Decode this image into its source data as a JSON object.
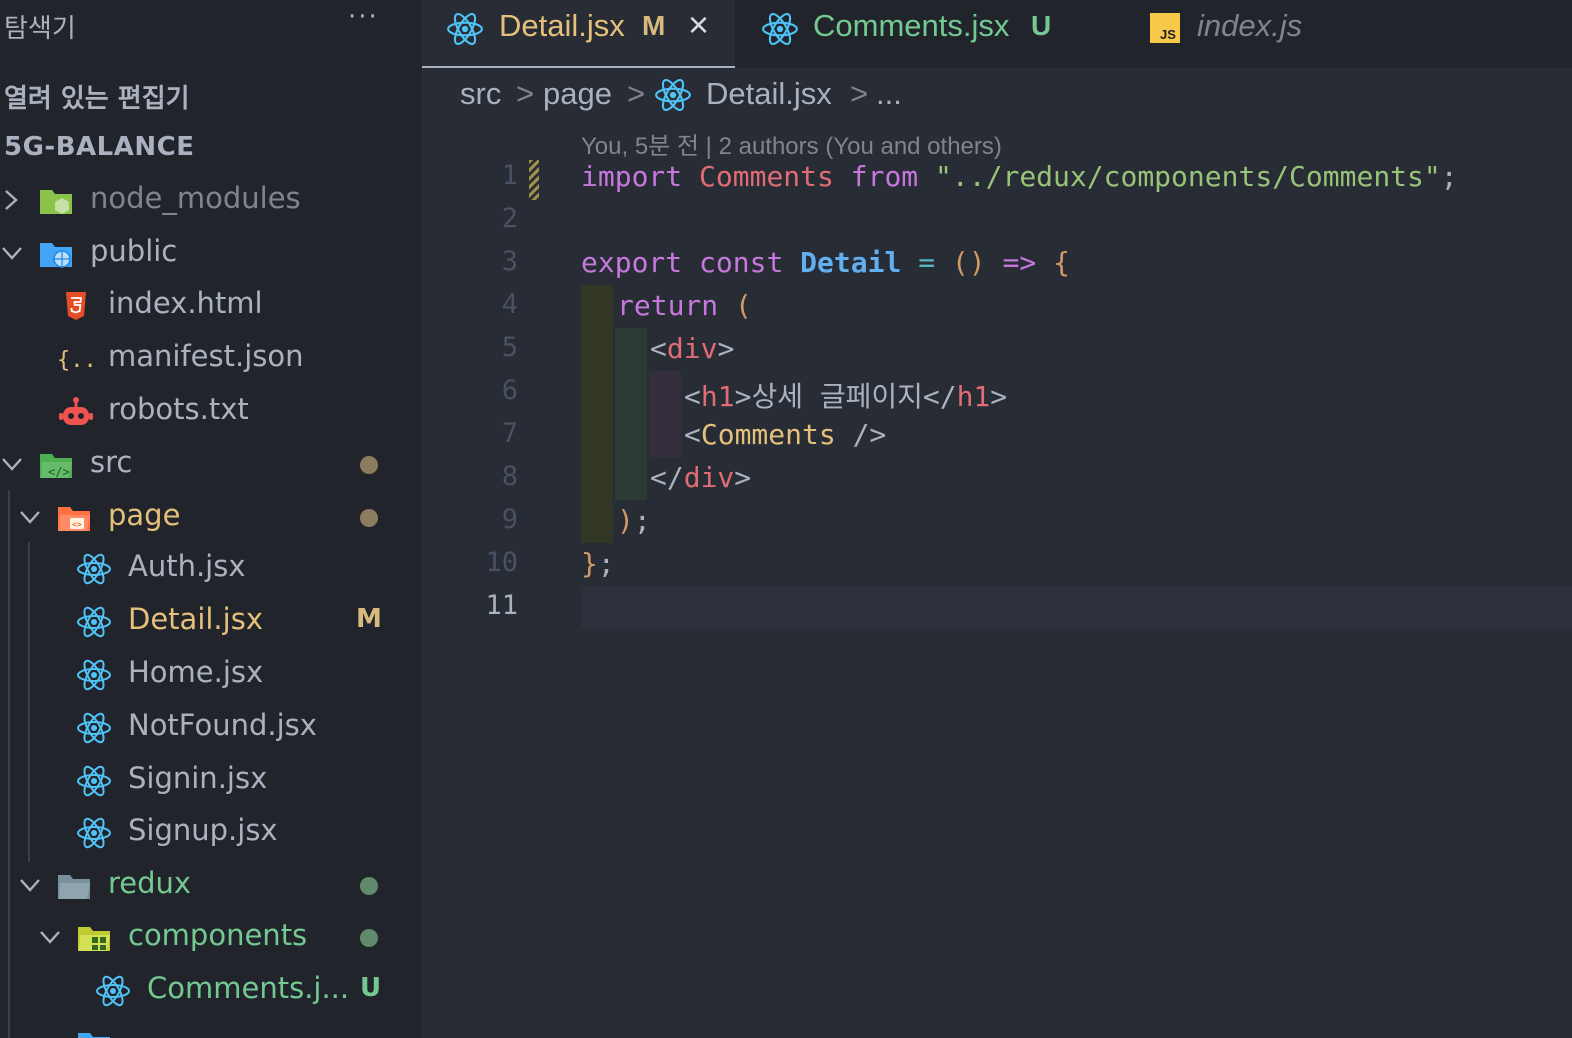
{
  "explorer": {
    "header": "탐색기",
    "more": "···",
    "open_editors": "열려 있는 편집기",
    "project": "5G-BALANCE"
  },
  "tree": [
    {
      "label": "node_modules",
      "icon": "node-folder-icon",
      "state": "collapsed",
      "color": "#7f848e"
    },
    {
      "label": "public",
      "icon": "public-folder-icon",
      "state": "expanded"
    },
    {
      "label": "index.html",
      "icon": "html5-icon"
    },
    {
      "label": "manifest.json",
      "icon": "json-icon"
    },
    {
      "label": "robots.txt",
      "icon": "robot-icon"
    },
    {
      "label": "src",
      "icon": "src-folder-icon",
      "state": "expanded",
      "badge": "dot"
    },
    {
      "label": "page",
      "icon": "page-folder-icon",
      "state": "expanded",
      "badge": "dot"
    },
    {
      "label": "Auth.jsx",
      "icon": "react-icon"
    },
    {
      "label": "Detail.jsx",
      "icon": "react-icon",
      "badge": "M"
    },
    {
      "label": "Home.jsx",
      "icon": "react-icon"
    },
    {
      "label": "NotFound.jsx",
      "icon": "react-icon"
    },
    {
      "label": "Signin.jsx",
      "icon": "react-icon"
    },
    {
      "label": "Signup.jsx",
      "icon": "react-icon"
    },
    {
      "label": "redux",
      "icon": "redux-folder-icon",
      "state": "expanded",
      "badge": "dot"
    },
    {
      "label": "components",
      "icon": "components-folder-icon",
      "state": "expanded",
      "badge": "dot"
    },
    {
      "label": "Comments.j...",
      "icon": "react-icon",
      "badge": "U"
    }
  ],
  "tabs": [
    {
      "label": "Detail.jsx",
      "status": "M",
      "close": "×"
    },
    {
      "label": "Comments.jsx",
      "status": "U"
    },
    {
      "label": "index.js"
    }
  ],
  "breadcrumb": {
    "parts": [
      "src",
      "page",
      "Detail.jsx",
      "..."
    ],
    "separator": ">"
  },
  "blame": "You, 5분 전 | 2 authors (You and others)",
  "code": {
    "line_numbers": [
      "1",
      "2",
      "3",
      "4",
      "5",
      "6",
      "7",
      "8",
      "9",
      "10",
      "11"
    ],
    "l1": {
      "kw": "import",
      "name": "Comments",
      "from": "from",
      "str": "\"../redux/components/Comments\"",
      "end": ";"
    },
    "l3": {
      "export": "export",
      "const": "const",
      "name": "Detail",
      "eq": "=",
      "parens": "()",
      "arrow": "=>",
      "brace": "{"
    },
    "l4": {
      "ret": "return",
      "paren": "("
    },
    "l5": {
      "open": "<",
      "tag": "div",
      "close": ">"
    },
    "l6": {
      "open": "<",
      "tag": "h1",
      "close": ">",
      "text": "상세 글페이지",
      "open2": "</",
      "tag2": "h1",
      "close2": ">"
    },
    "l7": {
      "open": "<",
      "comp": "Comments",
      "close": " />"
    },
    "l8": {
      "open": "</",
      "tag": "div",
      "close": ">"
    },
    "l9": {
      "paren": ")",
      "semi": ";"
    },
    "l10": {
      "brace": "}",
      "semi": ";"
    }
  },
  "colors": {
    "modified": "#d7ba7d",
    "untracked": "#73c991",
    "dot": "#8c7b5e",
    "dot_green": "#5f8b6c"
  }
}
